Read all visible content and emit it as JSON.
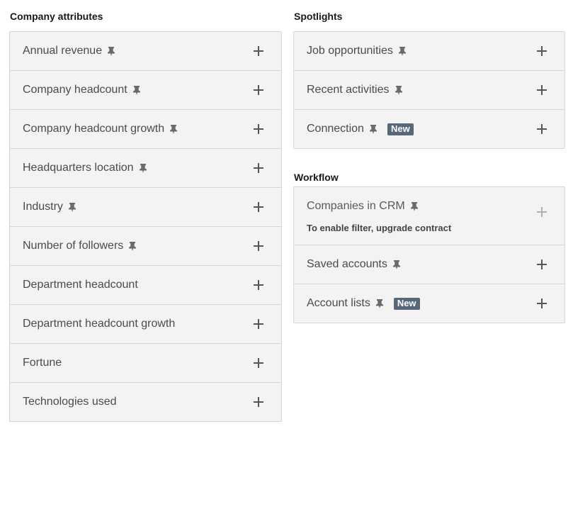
{
  "company_attributes": {
    "title": "Company attributes",
    "items": [
      {
        "label": "Annual revenue",
        "pinned": true
      },
      {
        "label": "Company headcount",
        "pinned": true
      },
      {
        "label": "Company headcount growth",
        "pinned": true
      },
      {
        "label": "Headquarters location",
        "pinned": true
      },
      {
        "label": "Industry",
        "pinned": true
      },
      {
        "label": "Number of followers",
        "pinned": true
      },
      {
        "label": "Department headcount",
        "pinned": false
      },
      {
        "label": "Department headcount growth",
        "pinned": false
      },
      {
        "label": "Fortune",
        "pinned": false
      },
      {
        "label": "Technologies used",
        "pinned": false
      }
    ]
  },
  "spotlights": {
    "title": "Spotlights",
    "items": [
      {
        "label": "Job opportunities",
        "pinned": true
      },
      {
        "label": "Recent activities",
        "pinned": true
      },
      {
        "label": "Connection",
        "pinned": true,
        "badge": "New"
      }
    ]
  },
  "workflow": {
    "title": "Workflow",
    "items": [
      {
        "label": "Companies in CRM",
        "pinned": true,
        "note": "To enable filter, upgrade contract",
        "disabled": true
      },
      {
        "label": "Saved accounts",
        "pinned": true
      },
      {
        "label": "Account lists",
        "pinned": true,
        "badge": "New"
      }
    ]
  },
  "icons": {
    "pin": "pin-icon",
    "add": "plus-icon"
  },
  "colors": {
    "panel_bg": "#f3f3f4",
    "border": "#d6d6d6",
    "badge_bg": "#56687a",
    "plus_enabled": "#555555",
    "plus_disabled": "#b0b0b0"
  }
}
